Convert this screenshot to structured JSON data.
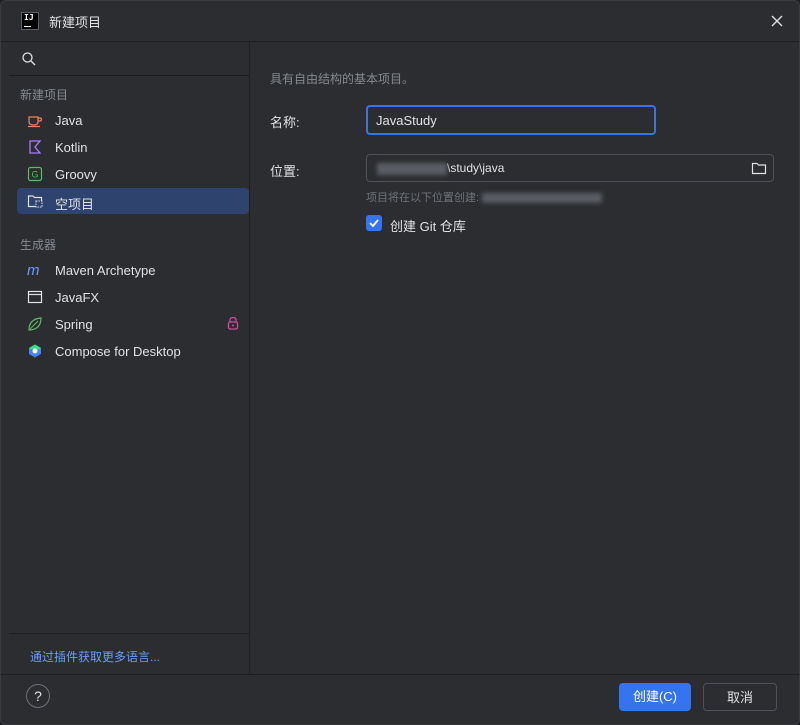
{
  "window": {
    "title": "新建项目"
  },
  "sidebar": {
    "section_new": "新建项目",
    "section_generators": "生成器",
    "items": [
      {
        "label": "Java",
        "icon": "java-icon"
      },
      {
        "label": "Kotlin",
        "icon": "kotlin-icon"
      },
      {
        "label": "Groovy",
        "icon": "groovy-icon"
      },
      {
        "label": "空项目",
        "icon": "empty-project-icon",
        "selected": true
      }
    ],
    "generators": [
      {
        "label": "Maven Archetype",
        "icon": "maven-icon"
      },
      {
        "label": "JavaFX",
        "icon": "javafx-icon"
      },
      {
        "label": "Spring",
        "icon": "spring-icon",
        "locked": true
      },
      {
        "label": "Compose for Desktop",
        "icon": "compose-icon"
      }
    ],
    "plugin_link": "通过插件获取更多语言..."
  },
  "main": {
    "description": "具有自由结构的基本项目。",
    "name_label": "名称:",
    "name_value": "JavaStudy",
    "location_label": "位置:",
    "location_value": "\\study\\java",
    "location_hint": "项目将在以下位置创建: ",
    "create_git_label": "创建 Git 仓库",
    "create_git_checked": true
  },
  "footer": {
    "help_label": "?",
    "create_label": "创建(C)",
    "cancel_label": "取消"
  },
  "colors": {
    "accent": "#3574f0",
    "background": "#2b2d30",
    "selected": "#2e436e",
    "link": "#6b9bfa"
  }
}
